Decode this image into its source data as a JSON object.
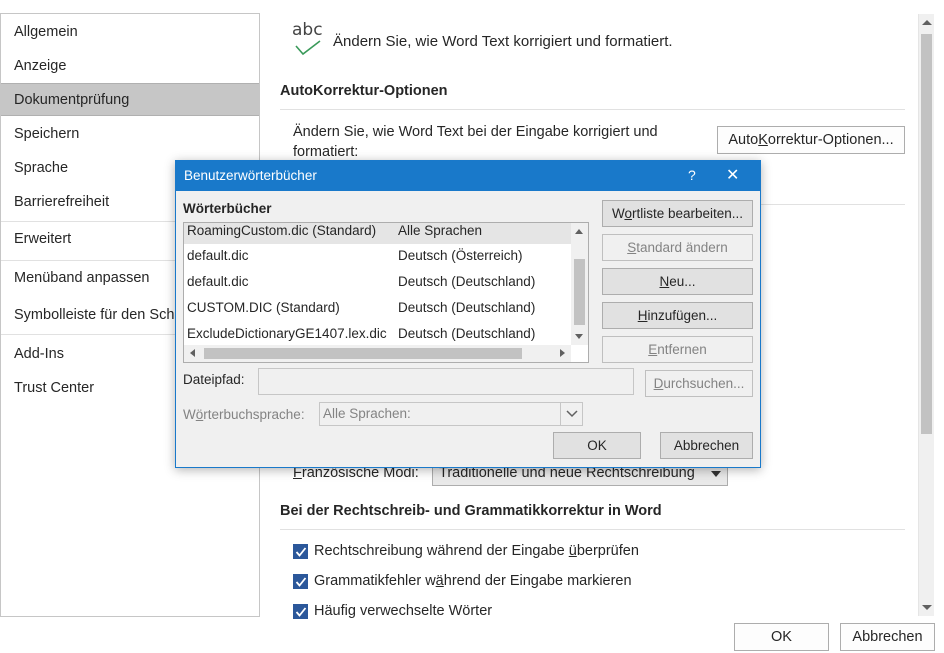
{
  "nav": {
    "items": [
      {
        "label": "Allgemein"
      },
      {
        "label": "Anzeige"
      },
      {
        "label": "Dokumentprüfung",
        "active": true
      },
      {
        "label": "Speichern"
      },
      {
        "label": "Sprache"
      },
      {
        "label": "Barrierefreiheit"
      },
      {
        "label": "Erweitert"
      },
      {
        "label": "Menüband anpassen"
      },
      {
        "label": "Symbolleiste für den Schnellzugriff"
      },
      {
        "label": "Add-Ins"
      },
      {
        "label": "Trust Center"
      }
    ]
  },
  "main": {
    "header_icon_text": "abc",
    "header_text": "Ändern Sie, wie Word Text korrigiert und formatiert.",
    "autocorrect_section_title": "AutoKorrektur-Optionen",
    "autocorrect_desc": "Ändern Sie, wie Word Text bei der Eingabe korrigiert und formatiert:",
    "autocorrect_button_pre": "Auto",
    "autocorrect_button_accel": "K",
    "autocorrect_button_post": "orrektur-Optionen...",
    "french_modes_accel": "F",
    "french_modes_label_rest": "ranzösische Modi:",
    "french_modes_value": "Traditionelle und neue Rechtschreibung",
    "word_section_title": "Bei der Rechtschreib- und Grammatikkorrektur in Word",
    "checks": [
      {
        "pre": "Rechtschreibung während der Eingabe ",
        "accel": "ü",
        "post": "berprüfen",
        "checked": true
      },
      {
        "pre": "Grammatikfehler w",
        "accel": "ä",
        "post": "hrend der Eingabe markieren",
        "checked": true
      },
      {
        "pre": "Häufig verwechselte Wörter",
        "accel": "",
        "post": "",
        "checked": true
      }
    ]
  },
  "footer": {
    "ok_label": "OK",
    "cancel_label": "Abbrechen"
  },
  "dialog": {
    "title": "Benutzerwörterbücher",
    "help_label": "?",
    "close_label": "✕",
    "list_label": "Wörterbücher",
    "dictionaries": [
      {
        "name": "RoamingCustom.dic (Standard)",
        "language": "Alle Sprachen",
        "selected": true
      },
      {
        "name": "default.dic",
        "language": "Deutsch (Österreich)"
      },
      {
        "name": "default.dic",
        "language": "Deutsch (Deutschland)"
      },
      {
        "name": "CUSTOM.DIC (Standard)",
        "language": "Deutsch (Deutschland)"
      },
      {
        "name": "ExcludeDictionaryGE1407.lex.dic",
        "language": "Deutsch (Deutschland)"
      }
    ],
    "buttons": {
      "edit_pre": "W",
      "edit_accel": "o",
      "edit_post": "rtliste bearbeiten...",
      "default_pre": "",
      "default_accel": "S",
      "default_post": "tandard ändern",
      "new_pre": "",
      "new_accel": "N",
      "new_post": "eu...",
      "add_pre": "",
      "add_accel": "H",
      "add_post": "inzufügen...",
      "remove_pre": "",
      "remove_accel": "E",
      "remove_post": "ntfernen",
      "browse_pre": "",
      "browse_accel": "D",
      "browse_post": "urchsuchen..."
    },
    "path_label": "Dateipfad:",
    "path_value": "",
    "lang_label_pre": "W",
    "lang_label_accel": "ö",
    "lang_label_post": "rterbuchsprache:",
    "lang_value": "Alle Sprachen:",
    "ok_label": "OK",
    "cancel_label": "Abbrechen"
  },
  "colors": {
    "accent": "#1979ca",
    "checkbox": "#2b579a",
    "nav_active": "#c6c6c6"
  }
}
